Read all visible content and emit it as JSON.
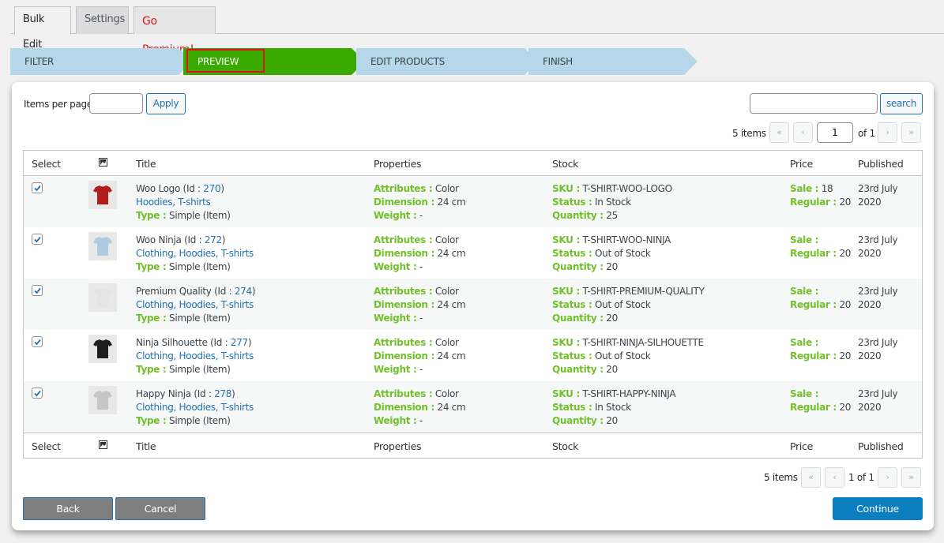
{
  "tabs": [
    {
      "label": "Bulk Edit",
      "active": true
    },
    {
      "label": "Settings",
      "active": false
    },
    {
      "label": "Go Premium!",
      "active": false
    }
  ],
  "steps": [
    {
      "label": "FILTER",
      "state": "inactive"
    },
    {
      "label": "PREVIEW",
      "state": "active"
    },
    {
      "label": "EDIT PRODUCTS",
      "state": "inactive"
    },
    {
      "label": "FINISH",
      "state": "inactive"
    }
  ],
  "colors": {
    "active_step": "#3aaa00",
    "inactive_step": "#b6d7ea",
    "label_green": "#72c02c",
    "link_blue": "#2271b1",
    "primary": "#0a7ebf",
    "highlight_red": "#e0141e"
  },
  "toolbar": {
    "items_per_page_label": "Items per page:",
    "items_per_page_value": "",
    "apply_label": "Apply",
    "search_value": "",
    "search_label": "search"
  },
  "pagination_top": {
    "count": "5 items",
    "first": "«",
    "prev": "‹",
    "current_page": "1",
    "of_label": "of 1",
    "next": "›",
    "last": "»"
  },
  "pagination_bottom": {
    "count": "5 items",
    "first": "«",
    "prev": "‹",
    "page_text": "1 of 1",
    "next": "›",
    "last": "»"
  },
  "table": {
    "headers": {
      "select": "Select",
      "image_icon": "image-icon",
      "title": "Title",
      "properties": "Properties",
      "stock": "Stock",
      "price": "Price",
      "published": "Published"
    },
    "labels": {
      "id": "Id :",
      "type": "Type :",
      "attributes": "Attributes :",
      "dimension": "Dimension :",
      "weight": "Weight :",
      "sku": "SKU :",
      "status": "Status :",
      "quantity": "Quantity :",
      "sale": "Sale :",
      "regular": "Regular :"
    },
    "rows": [
      {
        "checked": true,
        "name": "Woo Logo",
        "id": "270",
        "categories": "Hoodies, T-shirts",
        "type": "Simple (Item)",
        "attributes": "Color",
        "dimension": "24 cm",
        "weight": "-",
        "sku": "T-SHIRT-WOO-LOGO",
        "status": "In Stock",
        "quantity": "25",
        "sale": "18",
        "regular": "20",
        "published_line1": "23rd July",
        "published_line2": "2020",
        "shirt_color": "#b01c1c"
      },
      {
        "checked": true,
        "name": "Woo Ninja",
        "id": "272",
        "categories": "Clothing, Hoodies, T-shirts",
        "type": "Simple (Item)",
        "attributes": "Color",
        "dimension": "24 cm",
        "weight": "-",
        "sku": "T-SHIRT-WOO-NINJA",
        "status": "Out of Stock",
        "quantity": "20",
        "sale": "",
        "regular": "20",
        "published_line1": "23rd July",
        "published_line2": "2020",
        "shirt_color": "#aecbe0"
      },
      {
        "checked": true,
        "name": "Premium Quality",
        "id": "274",
        "categories": "Clothing, Hoodies, T-shirts",
        "type": "Simple (Item)",
        "attributes": "Color",
        "dimension": "24 cm",
        "weight": "-",
        "sku": "T-SHIRT-PREMIUM-QUALITY",
        "status": "Out of Stock",
        "quantity": "20",
        "sale": "",
        "regular": "20",
        "published_line1": "23rd July",
        "published_line2": "2020",
        "shirt_color": "#e4e4e4"
      },
      {
        "checked": true,
        "name": "Ninja Silhouette",
        "id": "277",
        "categories": "Clothing, Hoodies, T-shirts",
        "type": "Simple (Item)",
        "attributes": "Color",
        "dimension": "24 cm",
        "weight": "-",
        "sku": "T-SHIRT-NINJA-SILHOUETTE",
        "status": "Out of Stock",
        "quantity": "20",
        "sale": "",
        "regular": "20",
        "published_line1": "23rd July",
        "published_line2": "2020",
        "shirt_color": "#1e1e1e"
      },
      {
        "checked": true,
        "name": "Happy Ninja",
        "id": "278",
        "categories": "Clothing, Hoodies, T-shirts",
        "type": "Simple (Item)",
        "attributes": "Color",
        "dimension": "24 cm",
        "weight": "-",
        "sku": "T-SHIRT-HAPPY-NINJA",
        "status": "In Stock",
        "quantity": "20",
        "sale": "",
        "regular": "20",
        "published_line1": "23rd July",
        "published_line2": "2020",
        "shirt_color": "#c6c6c6"
      }
    ]
  },
  "footer": {
    "back_label": "Back",
    "cancel_label": "Cancel",
    "continue_label": "Continue"
  }
}
